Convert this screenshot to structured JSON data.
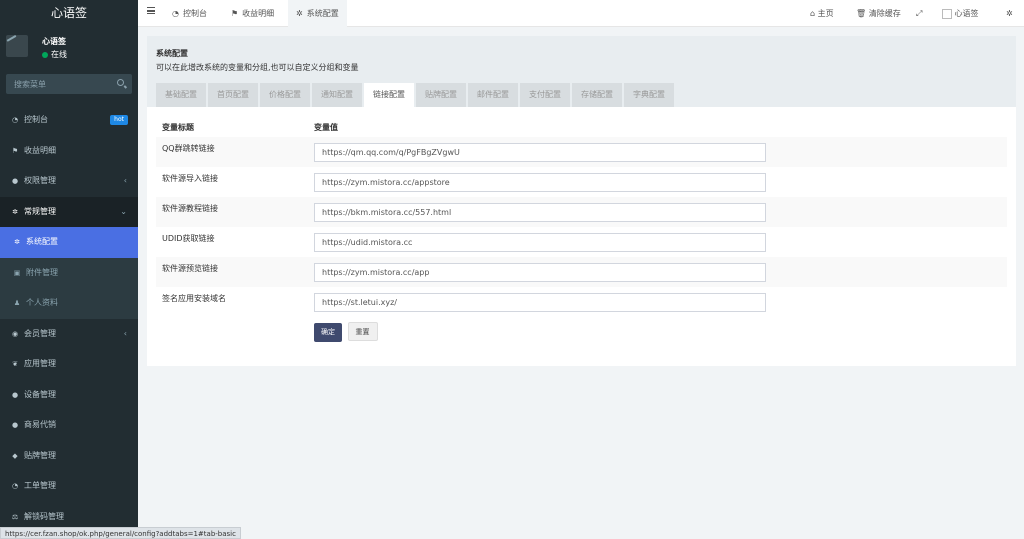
{
  "app": {
    "logo": "心语签"
  },
  "user": {
    "name": "心语签",
    "status": "在线"
  },
  "search": {
    "placeholder": "搜索菜单"
  },
  "sidebar": {
    "items": [
      {
        "label": "控制台",
        "icon": "dashboard-icon",
        "badge": "hot"
      },
      {
        "label": "收益明细",
        "icon": "flag-icon"
      },
      {
        "label": "权限管理",
        "icon": "users-icon",
        "caret": "‹"
      },
      {
        "label": "常规管理",
        "icon": "cogs-icon",
        "caret": "⌄"
      },
      {
        "label": "系统配置",
        "icon": "gear-icon"
      },
      {
        "label": "附件管理",
        "icon": "file-image-icon"
      },
      {
        "label": "个人资料",
        "icon": "user-icon"
      },
      {
        "label": "会员管理",
        "icon": "user-circle-icon",
        "caret": "‹"
      },
      {
        "label": "应用管理",
        "icon": "leaf-icon"
      },
      {
        "label": "设备管理",
        "icon": "dot-circle-icon"
      },
      {
        "label": "商易代销",
        "icon": "circle-icon"
      },
      {
        "label": "贴牌管理",
        "icon": "tags-icon"
      },
      {
        "label": "工单管理",
        "icon": "dashboard-icon"
      },
      {
        "label": "解锁码管理",
        "icon": "balance-icon"
      }
    ]
  },
  "topbar": {
    "tabs": [
      {
        "label": "控制台",
        "icon": "dashboard-icon"
      },
      {
        "label": "收益明细",
        "icon": "flag-icon"
      },
      {
        "label": "系统配置",
        "icon": "gear-icon"
      }
    ],
    "home": "主页",
    "clear_cache": "清除缓存",
    "username": "心语签"
  },
  "panel": {
    "title": "系统配置",
    "description": "可以在此增改系统的变量和分组,也可以自定义分组和变量",
    "tabs": [
      "基础配置",
      "首页配置",
      "价格配置",
      "通知配置",
      "链接配置",
      "贴牌配置",
      "邮件配置",
      "支付配置",
      "存储配置",
      "字典配置"
    ],
    "active_tab": "链接配置",
    "table": {
      "headers": [
        "变量标题",
        "变量值"
      ],
      "rows": [
        {
          "label": "QQ群跳转链接",
          "value": "https://qm.qq.com/q/PgFBgZVgwU"
        },
        {
          "label": "软件源导入链接",
          "value": "https://zym.mistora.cc/appstore"
        },
        {
          "label": "软件源教程链接",
          "value": "https://bkm.mistora.cc/557.html"
        },
        {
          "label": "UDID获取链接",
          "value": "https://udid.mistora.cc"
        },
        {
          "label": "软件源预览链接",
          "value": "https://zym.mistora.cc/app"
        },
        {
          "label": "签名应用安装域名",
          "value": "https://st.letui.xyz/"
        }
      ]
    },
    "buttons": {
      "confirm": "确定",
      "reset": "重置"
    }
  },
  "statusbar": {
    "url": "https://cer.fzan.shop/ok.php/general/config?addtabs=1#tab-basic"
  }
}
